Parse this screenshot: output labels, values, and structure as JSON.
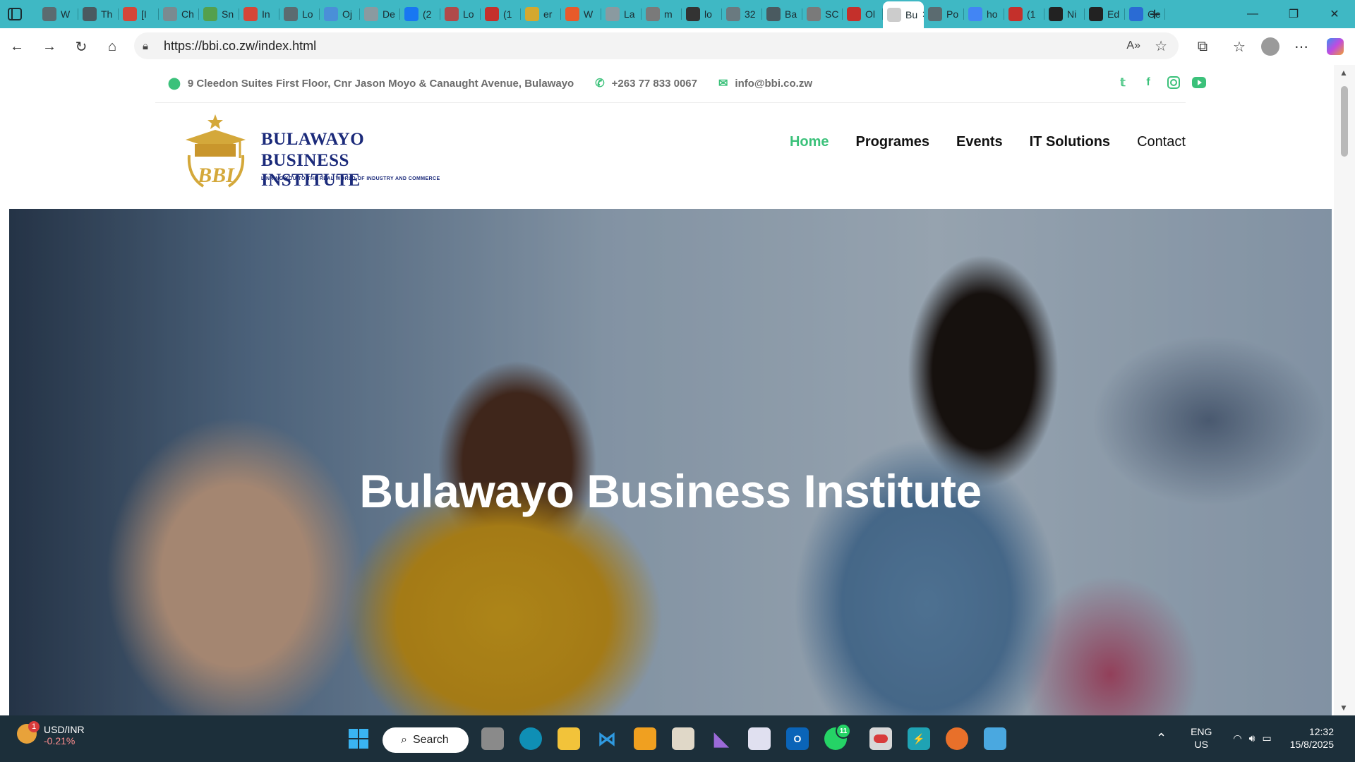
{
  "browser": {
    "tabs": [
      {
        "title": "W",
        "fav": "globe-icon",
        "color": "#5b6b70"
      },
      {
        "title": "Th",
        "fav": "tab-icon",
        "color": "#4a5a60"
      },
      {
        "title": "[I",
        "fav": "gmail-icon",
        "color": "#d44638"
      },
      {
        "title": "Ch",
        "fav": "tab-icon",
        "color": "#7a8a90"
      },
      {
        "title": "Sn",
        "fav": "tab-icon",
        "color": "#54a04d"
      },
      {
        "title": "In",
        "fav": "gmail-icon",
        "color": "#d44638"
      },
      {
        "title": "Lo",
        "fav": "globe-icon",
        "color": "#5b6b70"
      },
      {
        "title": "Oj",
        "fav": "tab-icon",
        "color": "#4a8fd8"
      },
      {
        "title": "De",
        "fav": "tab-icon",
        "color": "#8a9aa0"
      },
      {
        "title": "(2",
        "fav": "facebook-icon",
        "color": "#1877f2"
      },
      {
        "title": "Lo",
        "fav": "tab-icon",
        "color": "#b04a4a"
      },
      {
        "title": "(1",
        "fav": "youtube-icon",
        "color": "#c4302b"
      },
      {
        "title": "er",
        "fav": "tab-icon",
        "color": "#d4a82f"
      },
      {
        "title": "W",
        "fav": "tab-icon",
        "color": "#e85a2a"
      },
      {
        "title": "La",
        "fav": "tab-icon",
        "color": "#8a9aa0"
      },
      {
        "title": "m",
        "fav": "pdf-icon",
        "color": "#7a7a7a"
      },
      {
        "title": "lo",
        "fav": "tab-icon",
        "color": "#333333"
      },
      {
        "title": "32",
        "fav": "tab-icon",
        "color": "#6a7a80"
      },
      {
        "title": "Ba",
        "fav": "tab-icon",
        "color": "#4a5a60"
      },
      {
        "title": "SC",
        "fav": "pdf-icon",
        "color": "#7a7a7a"
      },
      {
        "title": "Ol",
        "fav": "youtube-icon",
        "color": "#c4302b"
      },
      {
        "title": "Bu",
        "fav": "tab-icon",
        "color": "#cccccc",
        "active": true
      },
      {
        "title": "Po",
        "fav": "globe-icon",
        "color": "#5b6b70"
      },
      {
        "title": "ho",
        "fav": "google-icon",
        "color": "#4285f4"
      },
      {
        "title": "(1",
        "fav": "youtube-icon",
        "color": "#c4302b"
      },
      {
        "title": "Ni",
        "fav": "github-icon",
        "color": "#222222"
      },
      {
        "title": "Ed",
        "fav": "github-icon",
        "color": "#222222"
      },
      {
        "title": "Ge",
        "fav": "tab-icon",
        "color": "#2a6bd4"
      }
    ],
    "url": "https://bbi.co.zw/index.html"
  },
  "site": {
    "address": "9 Cleedon Suites First Floor, Cnr Jason Moyo & Canaught Avenue, Bulawayo",
    "phone": "+263 77 833 0067",
    "email": "info@bbi.co.zw",
    "logo_line1": "BULAWAYO",
    "logo_line2": "BUSINESS INSTITUTE",
    "logo_tagline": "LINKING YOU TO THE REAL WORLD OF INDUSTRY AND COMMERCE",
    "nav": {
      "home": "Home",
      "programes": "Programes",
      "events": "Events",
      "it_solutions": "IT Solutions",
      "contact": "Contact"
    },
    "hero_title": "Bulawayo Business Institute"
  },
  "taskbar": {
    "widget_name": "USD/INR",
    "widget_change": "-0.21%",
    "widget_badge": "1",
    "search_label": "Search",
    "whatsapp_badge": "11",
    "lang_line1": "ENG",
    "lang_line2": "US",
    "time": "12:32",
    "date": "15/8/2025"
  }
}
